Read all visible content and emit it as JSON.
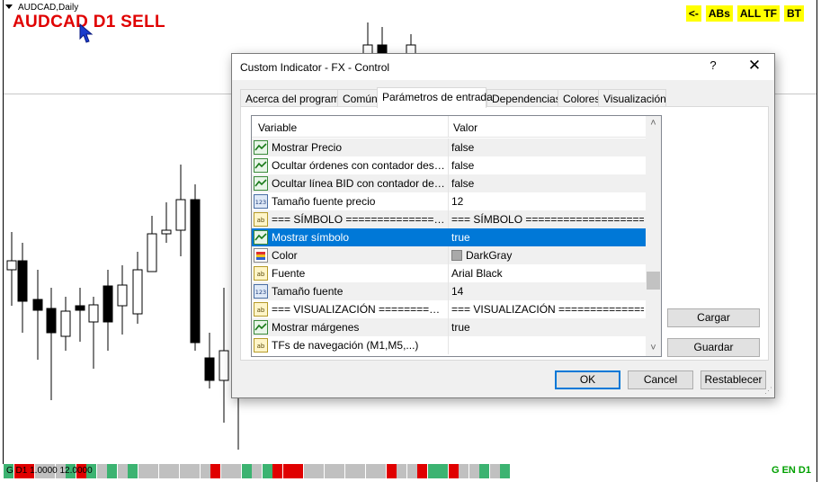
{
  "chart": {
    "title": "AUDCAD,Daily",
    "signal": "AUDCAD D1 SELL",
    "top_buttons": [
      "<-",
      "ABs",
      "ALL TF",
      "BT"
    ],
    "bottom_strip_text": "G D1 1.0000 12.0000",
    "bottom_right_text": "G EN D1",
    "colors": {
      "bear": "#000000",
      "bull": "#ffffff",
      "signal": "#e00000",
      "button_bg": "#ffff00",
      "strip_green": "#3cb371",
      "strip_red": "#e00000",
      "strip_gray": "#c0c0c0"
    },
    "bottom_strip_pattern": [
      "green",
      "red",
      "red",
      "gray",
      "gray",
      "gray",
      "green",
      "red",
      "green",
      "gray",
      "green",
      "gray",
      "green",
      "gray",
      "gray",
      "gray",
      "gray",
      "gray",
      "gray",
      "gray",
      "red",
      "gray",
      "gray",
      "green",
      "gray",
      "green",
      "red",
      "red",
      "red",
      "gray",
      "gray",
      "gray",
      "gray",
      "gray",
      "gray",
      "gray",
      "gray",
      "red",
      "gray",
      "gray",
      "red",
      "green",
      "green",
      "red",
      "gray",
      "gray",
      "green",
      "gray",
      "green"
    ]
  },
  "dialog": {
    "title": "Custom Indicator - FX - Control",
    "help_label": "?",
    "close_label": "✕",
    "tabs": [
      {
        "label": "Acerca del programa",
        "active": false
      },
      {
        "label": "Común",
        "active": false
      },
      {
        "label": "Parámetros de entrada",
        "active": true
      },
      {
        "label": "Dependencias",
        "active": false
      },
      {
        "label": "Colores",
        "active": false
      },
      {
        "label": "Visualización",
        "active": false
      }
    ],
    "grid": {
      "header_variable": "Variable",
      "header_value": "Valor",
      "rows": [
        {
          "icon": "bool-icon",
          "variable": "Mostrar Precio",
          "value": "false"
        },
        {
          "icon": "bool-icon",
          "variable": "Ocultar órdenes con contador desactivado",
          "value": "false"
        },
        {
          "icon": "bool-icon",
          "variable": "Ocultar línea BID con contador desactivado",
          "value": "false"
        },
        {
          "icon": "number-icon",
          "variable": "Tamaño fuente precio",
          "value": "12"
        },
        {
          "icon": "string-icon",
          "variable": "=== SÍMBOLO ====================================",
          "value": "=== SÍMBOLO ======================"
        },
        {
          "icon": "bool-icon",
          "variable": "Mostrar símbolo",
          "value": "true",
          "selected": true
        },
        {
          "icon": "color-icon",
          "variable": "Color",
          "value": "DarkGray",
          "swatch": "#a9a9a9"
        },
        {
          "icon": "string-icon",
          "variable": "Fuente",
          "value": "Arial Black"
        },
        {
          "icon": "number-icon",
          "variable": "Tamaño fuente",
          "value": "14"
        },
        {
          "icon": "string-icon",
          "variable": "=== VISUALIZACIÓN =================================",
          "value": "=== VISUALIZACIÓN ==============="
        },
        {
          "icon": "bool-icon",
          "variable": "Mostrar márgenes",
          "value": "true"
        },
        {
          "icon": "string-icon",
          "variable": "TFs de navegación (M1,M5,...)",
          "value": ""
        }
      ]
    },
    "side_buttons": {
      "load": "Cargar",
      "save": "Guardar"
    },
    "footer_buttons": {
      "ok": "OK",
      "cancel": "Cancel",
      "reset": "Restablecer"
    }
  }
}
